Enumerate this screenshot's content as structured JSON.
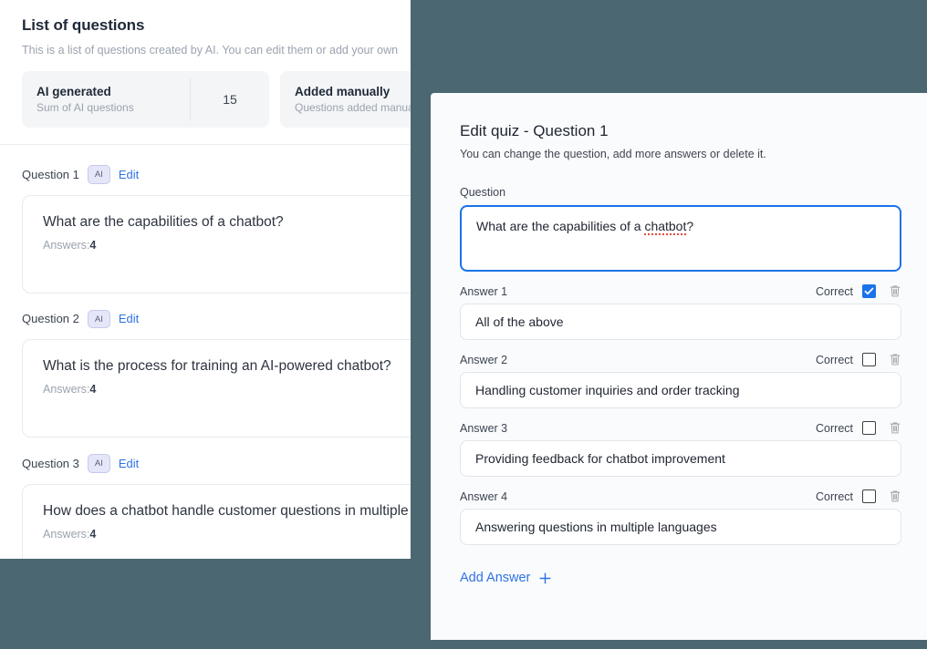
{
  "left_panel": {
    "title": "List of questions",
    "subtitle": "This is a list of questions created by AI. You can edit them or add your own",
    "stats": [
      {
        "name": "AI generated",
        "description": "Sum of AI questions",
        "value": "15"
      },
      {
        "name": "Added manually",
        "description": "Questions added manually",
        "value": ""
      }
    ],
    "questions": [
      {
        "label": "Question 1",
        "badge": "AI",
        "edit_label": "Edit",
        "text": "What are the capabilities of a chatbot?",
        "answers_label": "Answers:",
        "answers_count": "4"
      },
      {
        "label": "Question 2",
        "badge": "AI",
        "edit_label": "Edit",
        "text": "What is the process for training an AI-powered chatbot?",
        "answers_label": "Answers:",
        "answers_count": "4"
      },
      {
        "label": "Question 3",
        "badge": "AI",
        "edit_label": "Edit",
        "text": "How does a chatbot handle customer questions in multiple languages?",
        "answers_label": "Answers:",
        "answers_count": "4"
      }
    ]
  },
  "modal": {
    "title": "Edit quiz - Question 1",
    "subtitle": "You can change the question, add more answers or delete it.",
    "question_field_label": "Question",
    "question_value": "What are the capabilities of a chatbot?",
    "question_value_prefix": "What are the capabilities of a ",
    "question_value_misspelled": "chatbot",
    "question_value_suffix": "?",
    "answers": [
      {
        "label": "Answer 1",
        "correct_label": "Correct",
        "correct": true,
        "value": "All of the above"
      },
      {
        "label": "Answer 2",
        "correct_label": "Correct",
        "correct": false,
        "value": "Handling customer inquiries and order tracking"
      },
      {
        "label": "Answer 3",
        "correct_label": "Correct",
        "correct": false,
        "value": "Providing feedback for chatbot improvement"
      },
      {
        "label": "Answer 4",
        "correct_label": "Correct",
        "correct": false,
        "value": "Answering questions in multiple languages"
      }
    ],
    "add_answer_label": "Add Answer",
    "add_answer_icon": "plus-icon"
  },
  "colors": {
    "backdrop": "#4b6771",
    "accent_blue": "#2f72e6",
    "focus_blue": "#1a73e8",
    "checkbox_checked": "#1a73e8",
    "badge_bg": "#e5e7f8",
    "badge_border": "#c5c9ef",
    "modal_bg": "#fafbfd",
    "spellcheck_red": "#e04b3c"
  }
}
